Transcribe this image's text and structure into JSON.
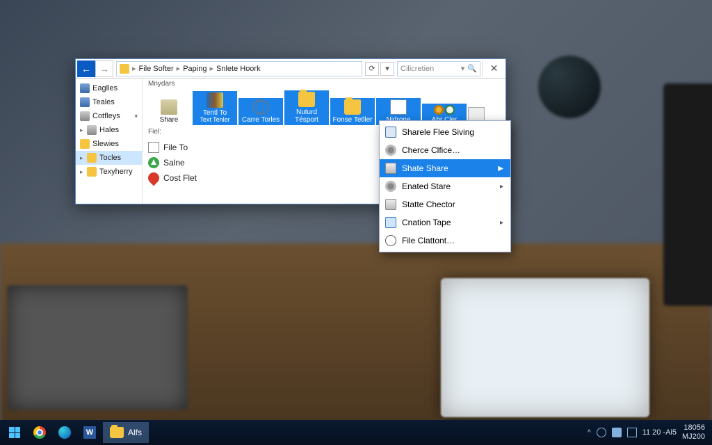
{
  "window": {
    "breadcrumb": [
      "File Softer",
      "Paping",
      "Snlete Hoork"
    ],
    "search_placeholder": "Cilicretien",
    "sidebar": {
      "items": [
        {
          "label": "Eaglles"
        },
        {
          "label": "Teales"
        },
        {
          "label": "Cotfleys"
        },
        {
          "label": "Hales"
        },
        {
          "label": "Slewies"
        },
        {
          "label": "Tocles"
        },
        {
          "label": "Texyherry"
        }
      ]
    },
    "section1_label": "Mnydars",
    "toolbar": [
      {
        "label": "Share",
        "icon": "share"
      },
      {
        "label": "Tentl To",
        "sub": "Text Tenler",
        "icon": "books"
      },
      {
        "label": "Carre Torles",
        "icon": "globe"
      },
      {
        "label": "Nuturd Tésport",
        "icon": "folder"
      },
      {
        "label": "Fonse Tetller",
        "icon": "folder"
      },
      {
        "label": "Nidrone",
        "icon": "page"
      },
      {
        "label": "Abr Cler",
        "icon": "gear"
      }
    ],
    "section2_label": "Fiel:",
    "files": [
      {
        "label": "File To",
        "icon": "doc"
      },
      {
        "label": "Salne",
        "icon": "green"
      },
      {
        "label": "Cost Flet",
        "icon": "pin"
      }
    ]
  },
  "context_menu": {
    "items": [
      {
        "label": "Sharele Flee Siving",
        "icon": "screen",
        "arrow": false
      },
      {
        "label": "Cherce Clfice…",
        "icon": "gear2",
        "arrow": false
      },
      {
        "label": "Shate Share",
        "icon": "drive",
        "arrow": true,
        "selected": true
      },
      {
        "label": "Enated Stare",
        "icon": "gear2",
        "arrow": true
      },
      {
        "label": "Statte Chector",
        "icon": "drive",
        "arrow": false
      },
      {
        "label": "Cnation Tape",
        "icon": "mon",
        "arrow": true
      },
      {
        "label": "File Clattont…",
        "icon": "clock2",
        "arrow": false
      }
    ]
  },
  "taskbar": {
    "active_task": "Alfs",
    "clock_top": "18056",
    "clock_bottom": "MJ200",
    "tray_text": "11 20 -Ai5"
  }
}
